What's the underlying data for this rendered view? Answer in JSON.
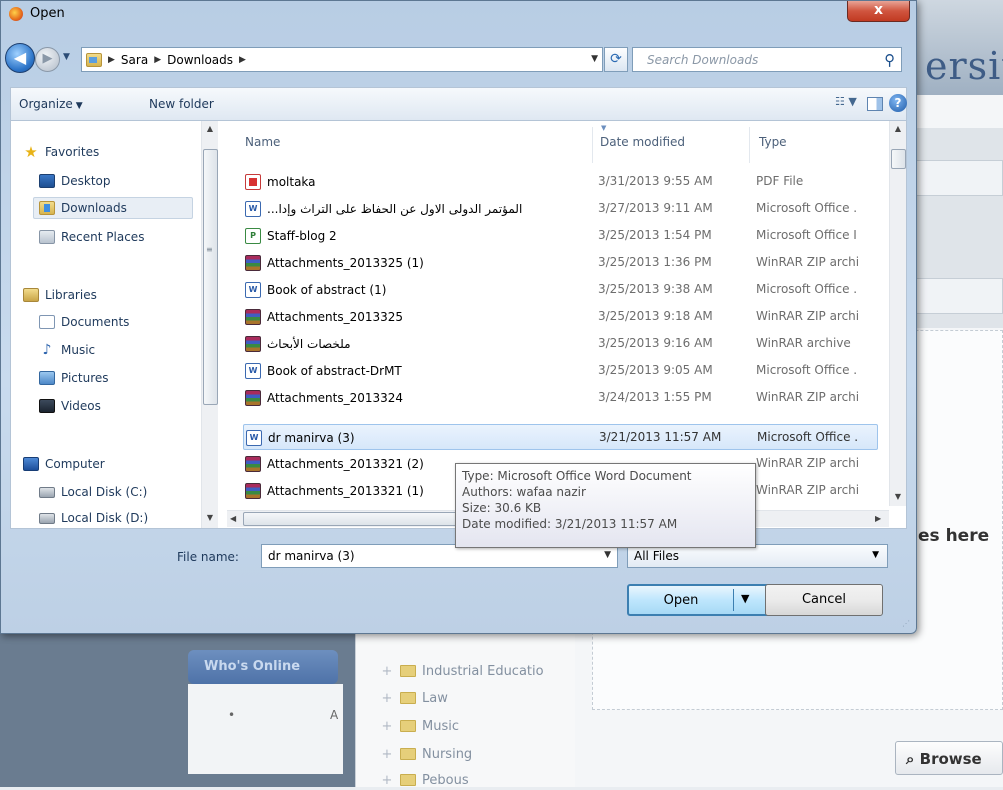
{
  "dialog": {
    "title": "Open",
    "close_label": "x"
  },
  "address": {
    "parts": [
      "Sara",
      "Downloads"
    ]
  },
  "search": {
    "placeholder": "Search Downloads"
  },
  "commands": {
    "organize": "Organize",
    "new_folder": "New folder"
  },
  "nav": {
    "favorites": "Favorites",
    "desktop": "Desktop",
    "downloads": "Downloads",
    "recent": "Recent Places",
    "libraries": "Libraries",
    "documents": "Documents",
    "music": "Music",
    "pictures": "Pictures",
    "videos": "Videos",
    "computer": "Computer",
    "disk_c": "Local Disk (C:)",
    "disk_d": "Local Disk (D:)"
  },
  "columns": {
    "name": "Name",
    "date": "Date modified",
    "type": "Type"
  },
  "files": [
    {
      "name": "moltaka",
      "date": "3/31/2013 9:55 AM",
      "type": "PDF File",
      "icon": "pdf"
    },
    {
      "name": "...المؤتمر الدولى الاول عن الحفاظ على التراث  وإدا",
      "date": "3/27/2013 9:11 AM",
      "type": "Microsoft Office .",
      "icon": "word"
    },
    {
      "name": "Staff-blog 2",
      "date": "3/25/2013 1:54 PM",
      "type": "Microsoft Office I",
      "icon": "pub"
    },
    {
      "name": "Attachments_2013325 (1)",
      "date": "3/25/2013 1:36 PM",
      "type": "WinRAR ZIP archi",
      "icon": "rar"
    },
    {
      "name": "Book of abstract (1)",
      "date": "3/25/2013 9:38 AM",
      "type": "Microsoft Office .",
      "icon": "word"
    },
    {
      "name": "Attachments_2013325",
      "date": "3/25/2013 9:18 AM",
      "type": "WinRAR ZIP archi",
      "icon": "rar"
    },
    {
      "name": "ملخصات الأبحاث",
      "date": "3/25/2013 9:16 AM",
      "type": "WinRAR archive",
      "icon": "rar"
    },
    {
      "name": "Book of abstract-DrMT",
      "date": "3/25/2013 9:05 AM",
      "type": "Microsoft Office .",
      "icon": "word"
    },
    {
      "name": "Attachments_2013324",
      "date": "3/24/2013 1:55 PM",
      "type": "WinRAR ZIP archi",
      "icon": "rar"
    },
    {
      "name": "dr manirva (3)",
      "date": "3/21/2013 11:57 AM",
      "type": "Microsoft Office .",
      "icon": "word",
      "selected": true
    },
    {
      "name": "Attachments_2013321 (2)",
      "date": "",
      "type": "WinRAR ZIP archi",
      "icon": "rar"
    },
    {
      "name": "Attachments_2013321 (1)",
      "date": "",
      "type": "WinRAR ZIP archi",
      "icon": "rar"
    }
  ],
  "tooltip": {
    "type": "Type: Microsoft Office Word Document",
    "authors": "Authors: wafaa nazir",
    "size": "Size: 30.6 KB",
    "modified": "Date modified: 3/21/2013 11:57 AM"
  },
  "filename": {
    "label": "File name:",
    "value": "dr manirva (3)"
  },
  "filter": {
    "selected": "All Files"
  },
  "buttons": {
    "open": "Open",
    "cancel": "Cancel"
  },
  "background": {
    "logo_fragment": "ersity",
    "whos_online": "Who's Online",
    "bullet_a": "A",
    "drop_text": "es here",
    "browse": "Browse",
    "tree": [
      "Industrial Educatio",
      "Law",
      "Music",
      "Nursing",
      "Pebous"
    ]
  }
}
